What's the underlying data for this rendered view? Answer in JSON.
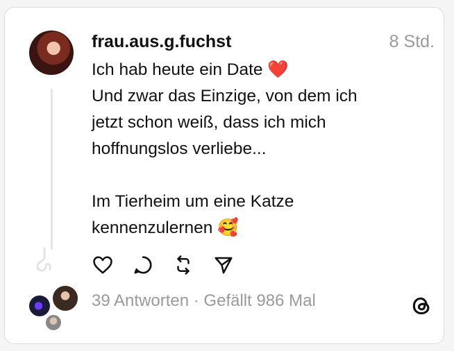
{
  "post": {
    "username": "frau.aus.g.fuchst",
    "time": "8 Std.",
    "lines": [
      "Ich hab heute ein Date ❤️",
      "Und zwar das Einzige, von dem ich",
      "jetzt schon weiß, dass ich mich",
      "hoffnungslos verliebe...",
      "",
      "Im Tierheim um eine Katze",
      "kennenzulernen 🥰"
    ]
  },
  "actions": [
    "heart-icon",
    "comment-icon",
    "repost-icon",
    "share-icon"
  ],
  "footer": {
    "stats": "39 Antworten · Gefällt 986 Mal"
  }
}
